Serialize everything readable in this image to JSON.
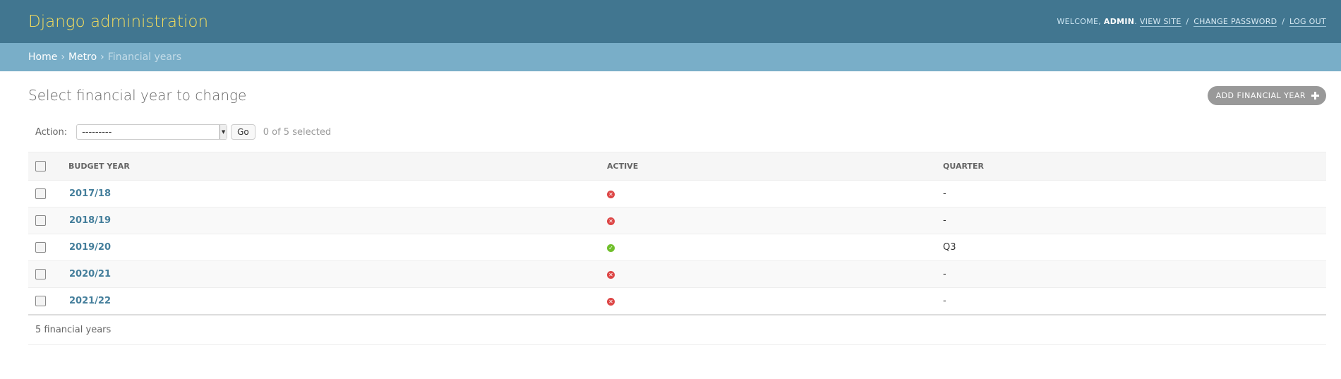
{
  "header": {
    "branding": "Django administration",
    "welcome": "Welcome,",
    "username": "admin",
    "view_site": "View site",
    "change_password": "Change password",
    "log_out": "Log out",
    "separator": "/"
  },
  "breadcrumbs": {
    "home": "Home",
    "app": "Metro",
    "current": "Financial years",
    "arrow": "›"
  },
  "page": {
    "title": "Select financial year to change",
    "add_button": "Add financial year"
  },
  "actions": {
    "label": "Action:",
    "selected_option": "---------",
    "go": "Go",
    "counter": "0 of 5 selected"
  },
  "table": {
    "headers": {
      "budget_year": "Budget year",
      "active": "Active",
      "quarter": "Quarter"
    },
    "rows": [
      {
        "year": "2017/18",
        "active": false,
        "active_icon": "no-icon",
        "quarter": "-"
      },
      {
        "year": "2018/19",
        "active": false,
        "active_icon": "no-icon",
        "quarter": "-"
      },
      {
        "year": "2019/20",
        "active": true,
        "active_icon": "yes-icon",
        "quarter": "Q3"
      },
      {
        "year": "2020/21",
        "active": false,
        "active_icon": "no-icon",
        "quarter": "-"
      },
      {
        "year": "2021/22",
        "active": false,
        "active_icon": "no-icon",
        "quarter": "-"
      }
    ]
  },
  "paginator": "5 financial years",
  "colors": {
    "header_bg": "#417690",
    "branding": "#f5dd5d",
    "breadcrumbs_bg": "#79aec8",
    "link": "#447e9b",
    "inactive": "#dd4646",
    "active": "#70bf2b"
  }
}
